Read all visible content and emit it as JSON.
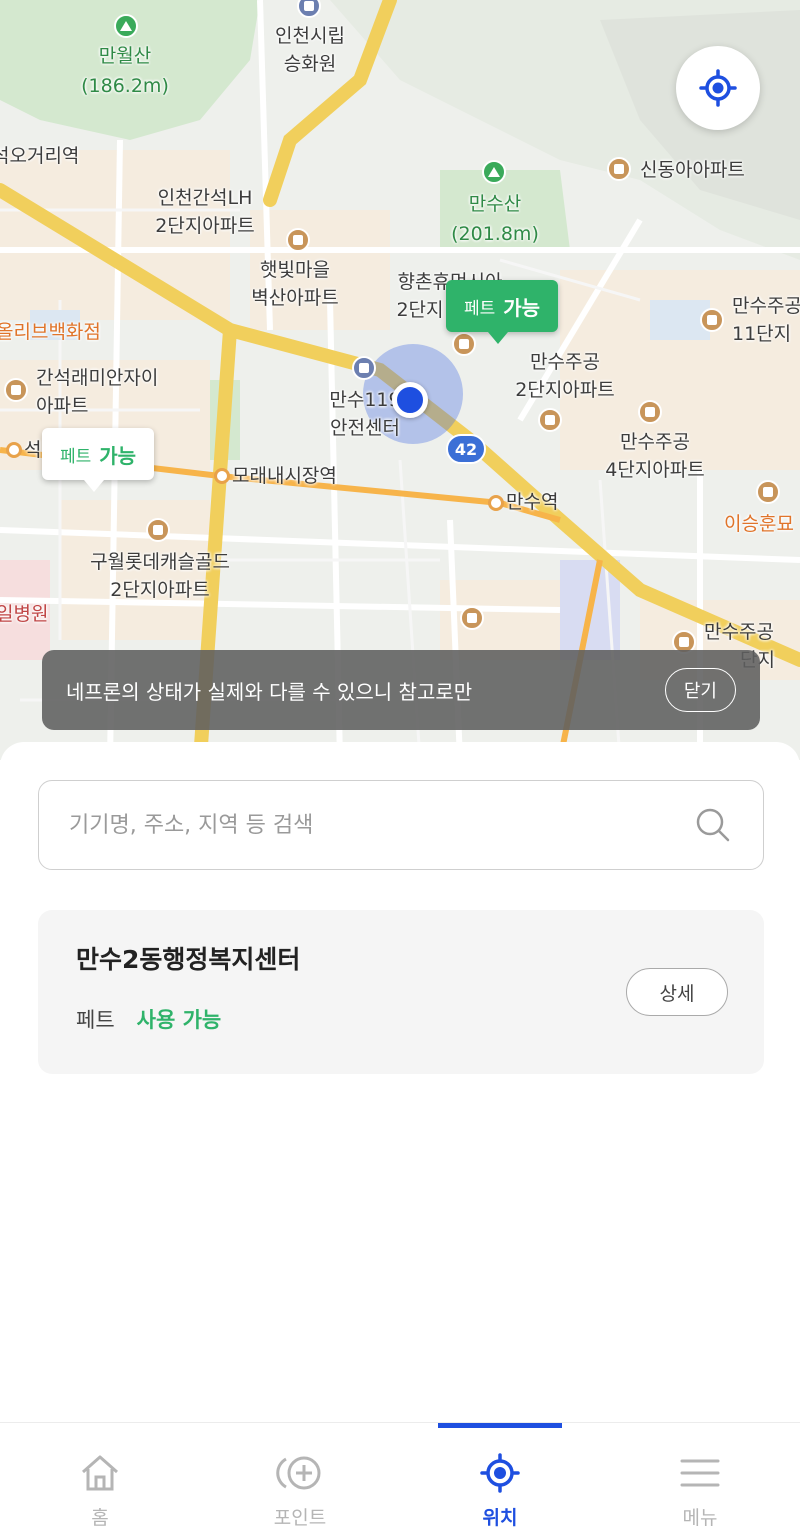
{
  "map": {
    "labels": {
      "mountain1_name": "만월산",
      "mountain1_height": "(186.2m)",
      "cityhall_annex1": "인천시립",
      "cityhall_annex2": "승화원",
      "crossroad": "석오거리역",
      "lh_complex1": "인천간석LH",
      "lh_complex2": "2단지아파트",
      "mountain2_name": "만수산",
      "mountain2_height": "(201.8m)",
      "sindong_apt": "신동아아파트",
      "hetbit1": "햇빛마을",
      "hetbit2": "벽산아파트",
      "hyangchon1": "향촌휴먼시아",
      "hyangchon2": "2단지",
      "olive_dept": "올리브백화점",
      "mansu_11_1": "만수주공",
      "mansu_11_2": "11단지",
      "ganseok1": "간석래미안자이",
      "ganseok2": "아파트",
      "safety1": "만수119",
      "safety2": "안전센터",
      "mansu_2_1": "만수주공",
      "mansu_2_2": "2단지아파트",
      "mansu_4_1": "만수주공",
      "mansu_4_2": "4단지아파트",
      "station_left": "석",
      "moraenae": "모래내시장역",
      "mansu_station": "만수역",
      "leeseunghun": "이승훈묘",
      "guwol1": "구월롯데캐슬골드",
      "guwol2": "2단지아파트",
      "hospital": "일병원",
      "mansu_bottom1": "만수주공",
      "mansu_bottom2": "단지",
      "route_number": "42"
    },
    "markers": {
      "active": {
        "key": "페트",
        "value": "가능"
      },
      "inactive": {
        "key": "페트",
        "value": "가능"
      }
    },
    "notice": {
      "text": "네프론의 상태가 실제와 다를 수 있으니 참고로만",
      "close_label": "닫기"
    }
  },
  "search": {
    "placeholder": "기기명, 주소, 지역 등 검색"
  },
  "result_card": {
    "title": "만수2동행정복지센터",
    "item_key": "페트",
    "item_status": "사용 가능",
    "detail_label": "상세"
  },
  "tabbar": {
    "tabs": [
      {
        "label": "홈",
        "icon": "home-icon"
      },
      {
        "label": "포인트",
        "icon": "points-icon"
      },
      {
        "label": "위치",
        "icon": "location-icon"
      },
      {
        "label": "메뉴",
        "icon": "menu-icon"
      }
    ],
    "active_index": 2
  },
  "colors": {
    "accent_blue": "#1e4fe0",
    "available_green": "#2fb36a",
    "road_yellow": "#f0d46a"
  }
}
